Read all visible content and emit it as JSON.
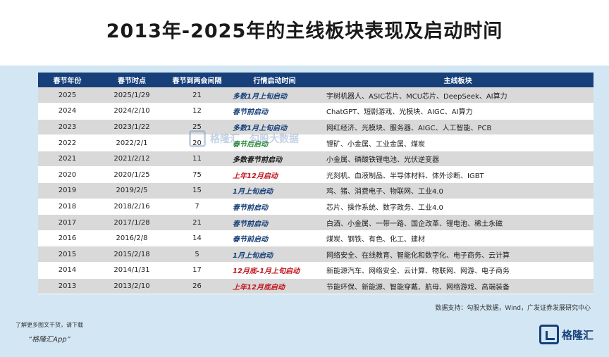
{
  "title": "2013年-2025年的主线板块表现及启动时间",
  "table": {
    "headers": [
      "春节年份",
      "春节时点",
      "春节到两会间隔",
      "行情启动时间",
      "主线板块"
    ],
    "rows": [
      {
        "year": "2025",
        "date": "2025/1/29",
        "gap": "21",
        "timing": "多数1月上旬启动",
        "timing_color": "blue",
        "boards": "宇树机器人、ASIC芯片、MCU芯片、DeepSeek、AI算力"
      },
      {
        "year": "2024",
        "date": "2024/2/10",
        "gap": "12",
        "timing": "春节前启动",
        "timing_color": "blue",
        "boards": "ChatGPT、短剧游戏、光模块、AIGC、AI算力"
      },
      {
        "year": "2023",
        "date": "2023/1/22",
        "gap": "25",
        "timing": "多数1月上旬启动",
        "timing_color": "blue",
        "boards": "网红经济、光模块、服务器、AIGC、人工智能、PCB"
      },
      {
        "year": "2022",
        "date": "2022/2/1",
        "gap": "20",
        "timing": "春节后启动",
        "timing_color": "green",
        "boards": "锂矿、小金属、工业金属、煤炭"
      },
      {
        "year": "2021",
        "date": "2021/2/12",
        "gap": "11",
        "timing": "多数春节前启动",
        "timing_color": "dark",
        "boards": "小金属、磷酸铁锂电池、光伏逆变器"
      },
      {
        "year": "2020",
        "date": "2020/1/25",
        "gap": "75",
        "timing": "上年12月启动",
        "timing_color": "red",
        "boards": "光刻机、血液制品、半导体材料、体外诊断、IGBT"
      },
      {
        "year": "2019",
        "date": "2019/2/5",
        "gap": "15",
        "timing": "1月上旬启动",
        "timing_color": "blue",
        "boards": "鸡、猪、消费电子、物联网、工业4.0"
      },
      {
        "year": "2018",
        "date": "2018/2/16",
        "gap": "7",
        "timing": "春节前启动",
        "timing_color": "blue",
        "boards": "芯片、操作系统、数字政务、工业4.0"
      },
      {
        "year": "2017",
        "date": "2017/1/28",
        "gap": "21",
        "timing": "春节前启动",
        "timing_color": "blue",
        "boards": "白酒、小金属、一带一路、国企改革、锂电池、稀土永磁"
      },
      {
        "year": "2016",
        "date": "2016/2/8",
        "gap": "14",
        "timing": "春节前启动",
        "timing_color": "blue",
        "boards": "煤炭、钢铁、有色、化工、建材"
      },
      {
        "year": "2015",
        "date": "2015/2/18",
        "gap": "5",
        "timing": "1月上旬启动",
        "timing_color": "blue",
        "boards": "网络安全、在线教育、智能化和数字化、电子商务、云计算"
      },
      {
        "year": "2014",
        "date": "2014/1/31",
        "gap": "17",
        "timing": "12月底-1月上旬启动",
        "timing_color": "red",
        "boards": "新能源汽车、网络安全、云计算、物联网、网游、电子商务"
      },
      {
        "year": "2013",
        "date": "2013/2/10",
        "gap": "26",
        "timing": "上年12月底启动",
        "timing_color": "red",
        "boards": "节能环保、新能源、智能穿戴、航母、网络游戏、高端装备"
      }
    ]
  },
  "source": "数据支持：勾股大数据，Wind，广发证券发展研究中心",
  "footer": {
    "note": "了解更多图文干货，请下载",
    "app": "“格隆汇App”"
  },
  "logo": {
    "text": "格隆汇"
  },
  "watermark": {
    "text1": "格隆汇",
    "text2": "勾股大数据"
  },
  "colors": {
    "header_bg": "#17407a",
    "panel_bg": "#d3e6f3",
    "blue": "#17407a",
    "green": "#2e8b3d",
    "red": "#c0141c"
  }
}
